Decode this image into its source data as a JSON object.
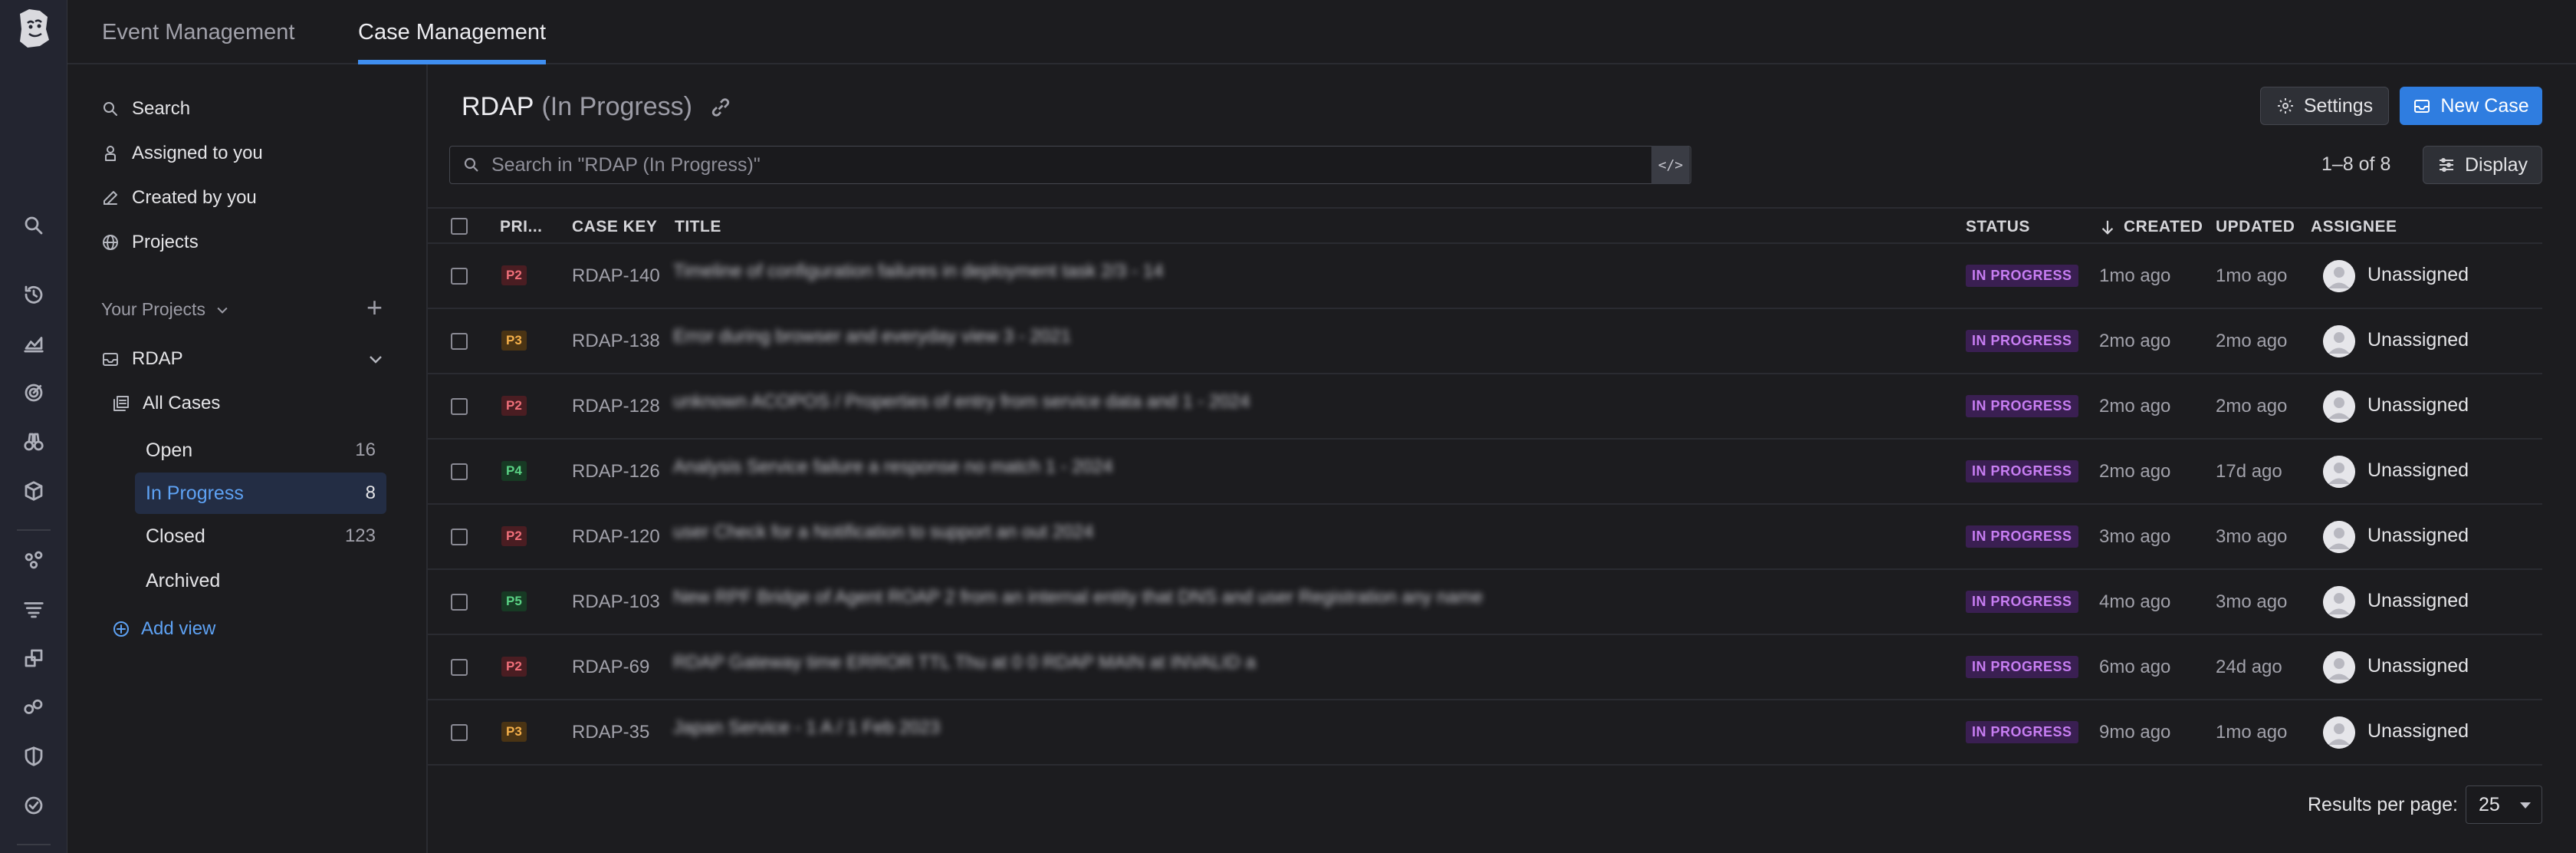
{
  "rail": {
    "icons": [
      "datadog-logo",
      "search-icon",
      "history-icon",
      "dashboards-icon",
      "monitors-icon",
      "watchdog-icon",
      "infrastructure-icon",
      "integrations-icon",
      "logs-icon",
      "apm-icon",
      "synthetics-icon",
      "security-icon",
      "service-mgmt-icon"
    ]
  },
  "tabs": [
    {
      "label": "Event Management",
      "active": false
    },
    {
      "label": "Case Management",
      "active": true
    }
  ],
  "nav": {
    "items": [
      {
        "label": "Search",
        "icon": "search-icon"
      },
      {
        "label": "Assigned to you",
        "icon": "user-icon"
      },
      {
        "label": "Created by you",
        "icon": "pencil-icon"
      },
      {
        "label": "Projects",
        "icon": "globe-icon"
      }
    ],
    "your_projects_label": "Your Projects",
    "project": {
      "name": "RDAP"
    },
    "all_cases_label": "All Cases",
    "views": [
      {
        "label": "Open",
        "count": "16"
      },
      {
        "label": "In Progress",
        "count": "8",
        "active": true
      },
      {
        "label": "Closed",
        "count": "123"
      },
      {
        "label": "Archived",
        "count": ""
      }
    ],
    "add_view_label": "Add view"
  },
  "header": {
    "title": "RDAP",
    "subtitle": "(In Progress)",
    "settings_label": "Settings",
    "new_case_label": "New Case",
    "search_placeholder": "Search in \"RDAP (In Progress)\"",
    "range_text": "1–8 of 8",
    "display_label": "Display"
  },
  "table": {
    "columns": {
      "priority": "PRI...",
      "case_key": "CASE KEY",
      "title": "TITLE",
      "status": "STATUS",
      "created": "CREATED",
      "updated": "UPDATED",
      "assignee": "ASSIGNEE"
    },
    "rows": [
      {
        "priority": "P2",
        "key": "RDAP-140",
        "title": "Timeline of configuration failures in deployment task 2/3 - 14",
        "status": "IN PROGRESS",
        "created": "1mo ago",
        "updated": "1mo ago",
        "assignee": "Unassigned"
      },
      {
        "priority": "P3",
        "key": "RDAP-138",
        "title": "Error during browser and everyday view 3 - 2021",
        "status": "IN PROGRESS",
        "created": "2mo ago",
        "updated": "2mo ago",
        "assignee": "Unassigned"
      },
      {
        "priority": "P2",
        "key": "RDAP-128",
        "title": "unknown ACOPOS / Properties of entry from service data and 1 - 2024",
        "status": "IN PROGRESS",
        "created": "2mo ago",
        "updated": "2mo ago",
        "assignee": "Unassigned"
      },
      {
        "priority": "P4",
        "key": "RDAP-126",
        "title": "Analysis Service failure a response no match 1 - 2024",
        "status": "IN PROGRESS",
        "created": "2mo ago",
        "updated": "17d ago",
        "assignee": "Unassigned"
      },
      {
        "priority": "P2",
        "key": "RDAP-120",
        "title": "user Check for a Notification to support an out 2024",
        "status": "IN PROGRESS",
        "created": "3mo ago",
        "updated": "3mo ago",
        "assignee": "Unassigned"
      },
      {
        "priority": "P5",
        "key": "RDAP-103",
        "title": "New RPF Bridge of Agent ROAP 2 from an internal entity that DNS and user Registration any name",
        "status": "IN PROGRESS",
        "created": "4mo ago",
        "updated": "3mo ago",
        "assignee": "Unassigned"
      },
      {
        "priority": "P2",
        "key": "RDAP-69",
        "title": "RDAP Gateway time ERROR TTL Thu at 0 0 RDAP MAIN at INVALID a",
        "status": "IN PROGRESS",
        "created": "6mo ago",
        "updated": "24d ago",
        "assignee": "Unassigned"
      },
      {
        "priority": "P3",
        "key": "RDAP-35",
        "title": "Japan Service - 1 A / 1 Feb 2023",
        "status": "IN PROGRESS",
        "created": "9mo ago",
        "updated": "1mo ago",
        "assignee": "Unassigned"
      }
    ]
  },
  "footer": {
    "results_per_page_label": "Results per page:",
    "results_per_page_value": "25"
  }
}
